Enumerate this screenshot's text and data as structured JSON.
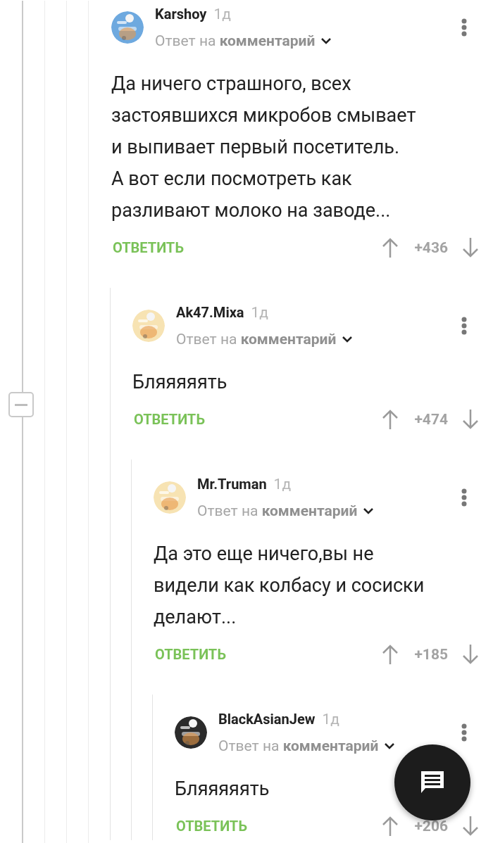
{
  "thread": {
    "collapse_button": {
      "expanded": true
    }
  },
  "comments": [
    {
      "author": "Karshoy",
      "time": "1д",
      "meta_prefix": "Ответ на",
      "meta_link": "комментарий",
      "lines": [
        "Да ничего страшного, всех",
        "застоявшихся микробов смывает",
        "и выпивает первый посетитель.",
        "А вот если посмотреть как",
        "разливают молоко на заводе..."
      ],
      "reply": "ОТВЕТИТЬ",
      "rating": "+436",
      "children": [
        {
          "author": "Ak47.Mixa",
          "time": "1д",
          "meta_prefix": "Ответ на",
          "meta_link": "комментарий",
          "lines": [
            "Бляяяяять"
          ],
          "reply": "ОТВЕТИТЬ",
          "rating": "+474",
          "children": [
            {
              "author": "Mr.Truman",
              "time": "1д",
              "meta_prefix": "Ответ на",
              "meta_link": "комментарий",
              "lines": [
                "Да это еще ничего,вы не",
                "видели как колбасу и сосиски",
                "делают..."
              ],
              "reply": "ОТВЕТИТЬ",
              "rating": "+185",
              "children": [
                {
                  "author": "BlackAsianJew",
                  "time": "1д",
                  "meta_prefix": "Ответ на",
                  "meta_link": "комментарий",
                  "lines": [
                    "Бляяяяять"
                  ],
                  "reply": "ОТВЕТИТЬ",
                  "rating": "+206"
                }
              ]
            }
          ]
        }
      ]
    }
  ]
}
